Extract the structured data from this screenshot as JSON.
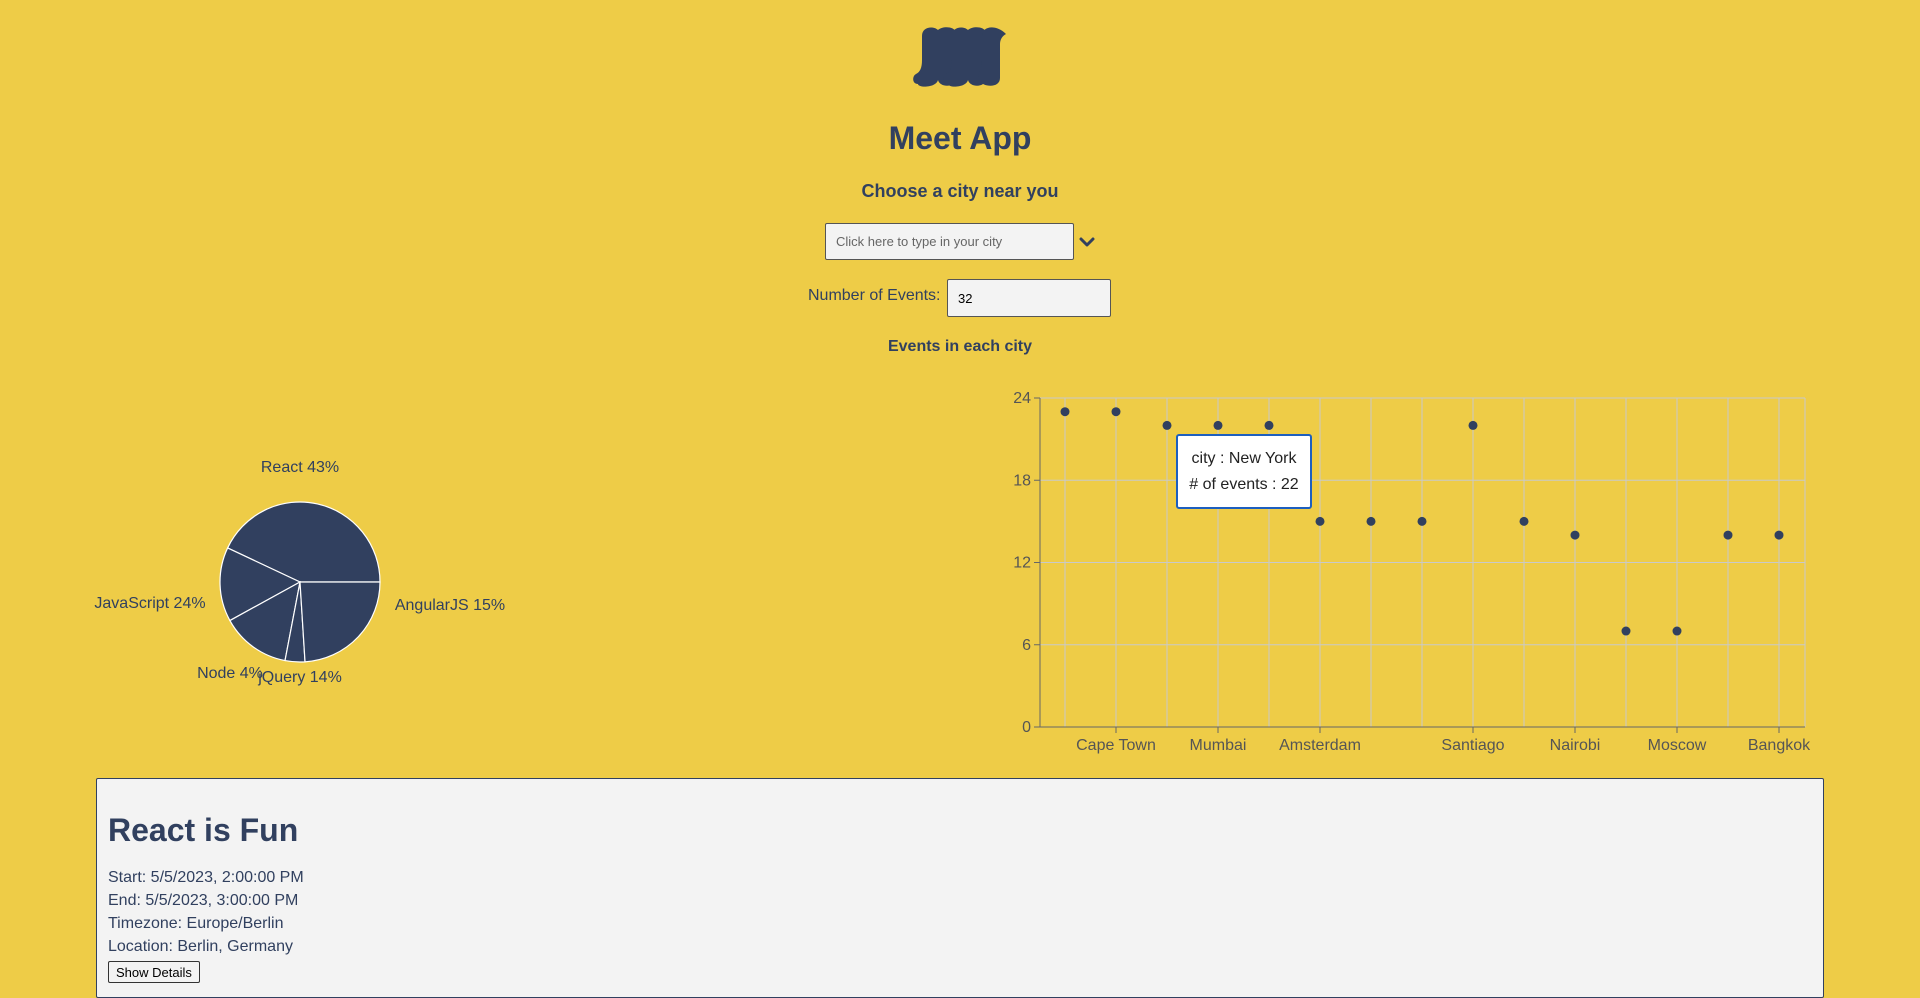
{
  "app": {
    "title": "Meet App",
    "accent": "#31405f",
    "background": "#eecc47"
  },
  "city_search": {
    "heading": "Choose a city near you",
    "placeholder": "Click here to type in your city",
    "value": ""
  },
  "number_of_events": {
    "label": "Number of Events:",
    "value": "32"
  },
  "charts_heading": "Events in each city",
  "chart_data": [
    {
      "type": "pie",
      "title": "",
      "slices": [
        {
          "label": "React 43%",
          "value": 43
        },
        {
          "label": "AngularJS 15%",
          "value": 15
        },
        {
          "label": "jQuery 14%",
          "value": 14
        },
        {
          "label": "Node 4%",
          "value": 4
        },
        {
          "label": "JavaScript 24%",
          "value": 24
        }
      ],
      "color": "#31405f"
    },
    {
      "type": "scatter",
      "title": "",
      "xlabel": "",
      "ylabel": "",
      "ylim": [
        0,
        24
      ],
      "yticks": [
        0,
        6,
        12,
        18,
        24
      ],
      "grid": true,
      "x_tick_labels": [
        "Cape Town",
        "Mumbai",
        "Amsterdam",
        "Santiago",
        "Nairobi",
        "Moscow",
        "Bangkok"
      ],
      "points": [
        {
          "x": 0,
          "y": 23
        },
        {
          "x": 1,
          "y": 23,
          "city": "Cape Town"
        },
        {
          "x": 2,
          "y": 22
        },
        {
          "x": 3,
          "y": 22,
          "city": "Mumbai"
        },
        {
          "x": 4,
          "y": 22
        },
        {
          "x": 5,
          "y": 15,
          "city": "Amsterdam"
        },
        {
          "x": 6,
          "y": 15
        },
        {
          "x": 7,
          "y": 15
        },
        {
          "x": 8,
          "y": 22,
          "city": "Santiago"
        },
        {
          "x": 9,
          "y": 15
        },
        {
          "x": 10,
          "y": 14,
          "city": "Nairobi"
        },
        {
          "x": 11,
          "y": 7
        },
        {
          "x": 12,
          "y": 7,
          "city": "Moscow"
        },
        {
          "x": 13,
          "y": 14
        },
        {
          "x": 14,
          "y": 14,
          "city": "Bangkok"
        }
      ],
      "tooltip": {
        "line1": "city : New York",
        "line2": "# of events : 22"
      }
    }
  ],
  "event": {
    "title": "React is Fun",
    "start": "Start: 5/5/2023, 2:00:00 PM",
    "end": "End: 5/5/2023, 3:00:00 PM",
    "timezone": "Timezone: Europe/Berlin",
    "location": "Location: Berlin, Germany",
    "details_button": "Show Details"
  }
}
